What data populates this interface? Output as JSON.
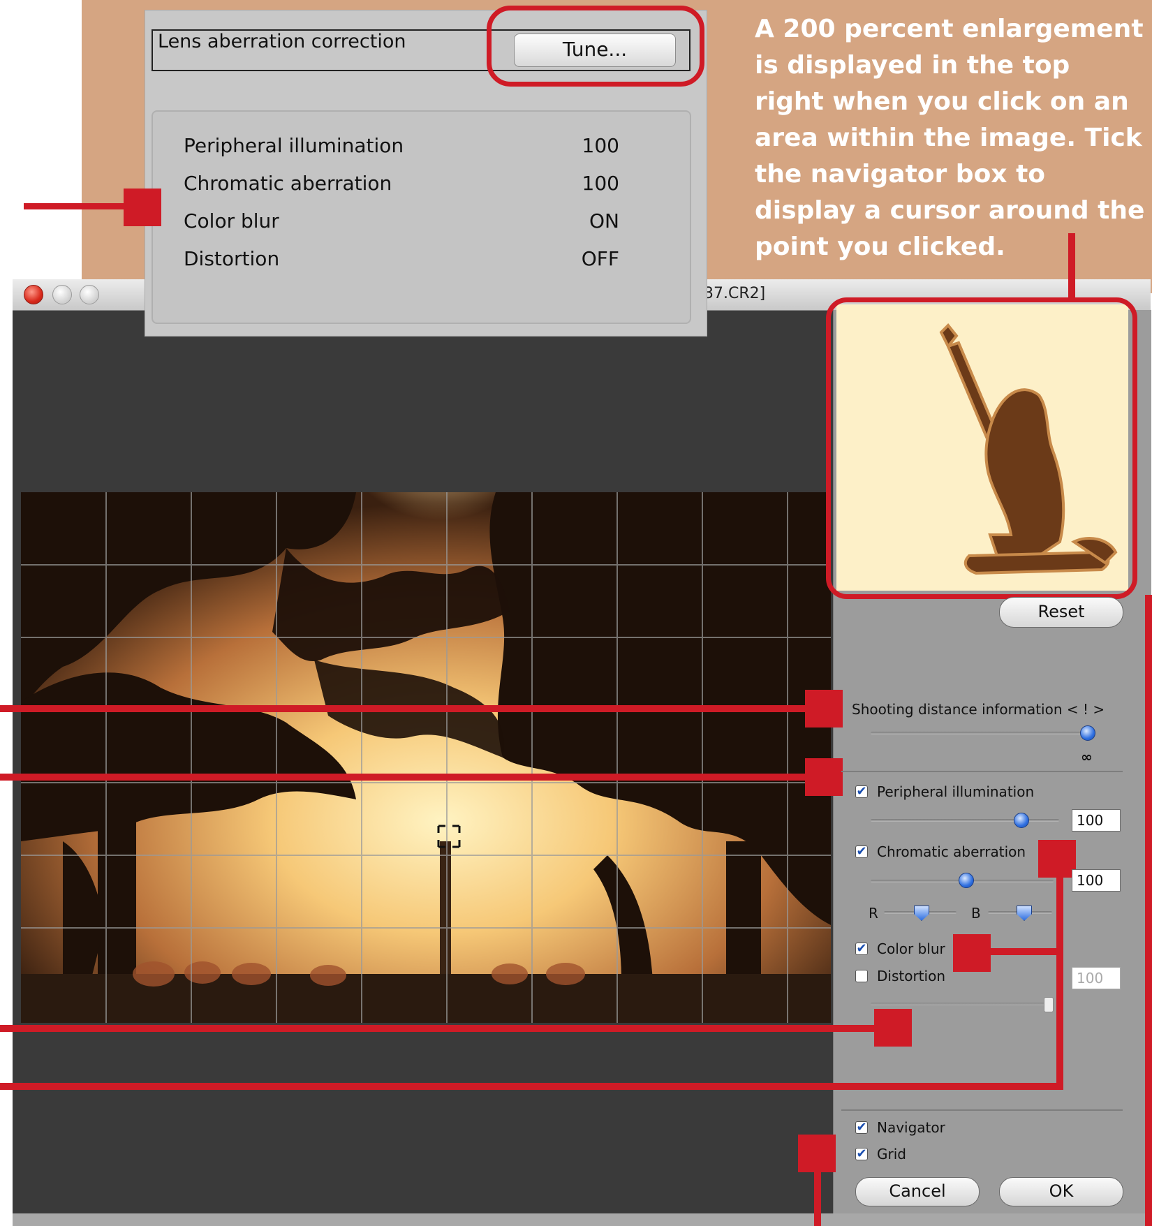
{
  "window": {
    "title_partial": "37.CR2]"
  },
  "callout": {
    "header_label": "Lens aberration correction",
    "tune_label": "Tune...",
    "rows": [
      {
        "label": "Peripheral illumination",
        "value": "100"
      },
      {
        "label": "Chromatic aberration",
        "value": "100"
      },
      {
        "label": "Color blur",
        "value": "ON"
      },
      {
        "label": "Distortion",
        "value": "OFF"
      }
    ]
  },
  "instruction": "A 200 percent enlargement is displayed in the top right when you click on an area within the image. Tick the navigator box to display a cursor around the point you clicked.",
  "panel": {
    "reset_label": "Reset",
    "shooting_distance": {
      "label": "Shooting distance information < ! >",
      "value_label": "∞"
    },
    "peripheral": {
      "label": "Peripheral illumination",
      "checked": true,
      "value": "100"
    },
    "chromatic": {
      "label": "Chromatic aberration",
      "checked": true,
      "value": "100",
      "r_label": "R",
      "b_label": "B"
    },
    "color_blur": {
      "label": "Color blur",
      "checked": true
    },
    "distortion": {
      "label": "Distortion",
      "checked": false,
      "value": "100"
    },
    "navigator": {
      "label": "Navigator",
      "checked": true
    },
    "grid": {
      "label": "Grid",
      "checked": true
    },
    "cancel_label": "Cancel",
    "ok_label": "OK"
  },
  "colors": {
    "accent_red": "#cf1b26",
    "background_tan": "#d5a582",
    "slider_blue": "#2f6fe0"
  }
}
